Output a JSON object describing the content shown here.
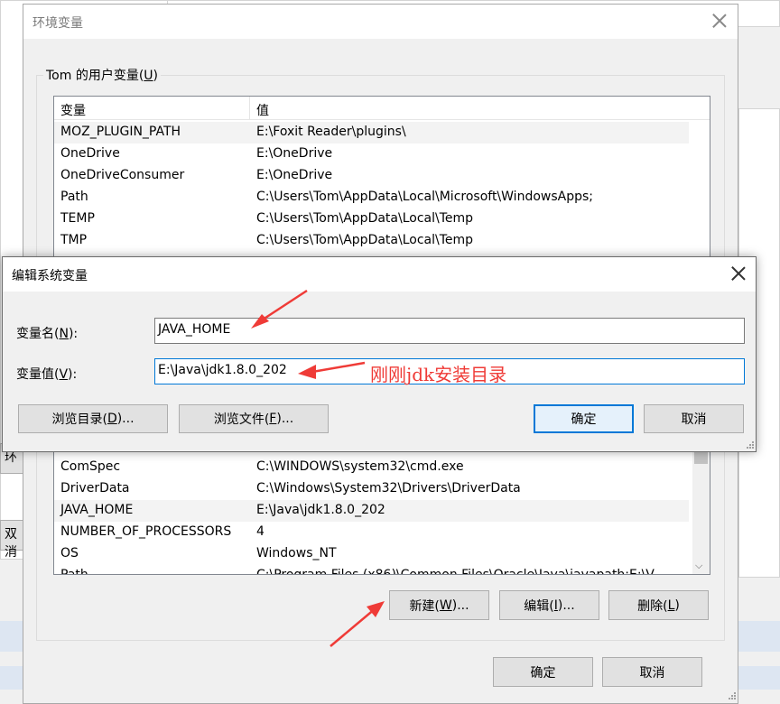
{
  "background": {
    "partial_labels": [
      "环",
      "双消"
    ],
    "accent_colors": {
      "highlight_strip": "#dde6f2",
      "annotation": "#ef3b37",
      "focus_blue": "#0078d7"
    }
  },
  "env_dialog": {
    "title": "环境变量",
    "user_vars": {
      "group_label_prefix": "Tom 的用户变量(",
      "group_label_key": "U",
      "group_label_suffix": ")",
      "columns": [
        "变量",
        "值"
      ],
      "rows": [
        {
          "name": "MOZ_PLUGIN_PATH",
          "value": "E:\\Foxit Reader\\plugins\\"
        },
        {
          "name": "OneDrive",
          "value": "E:\\OneDrive"
        },
        {
          "name": "OneDriveConsumer",
          "value": "E:\\OneDrive"
        },
        {
          "name": "Path",
          "value": "C:\\Users\\Tom\\AppData\\Local\\Microsoft\\WindowsApps;"
        },
        {
          "name": "TEMP",
          "value": "C:\\Users\\Tom\\AppData\\Local\\Temp"
        },
        {
          "name": "TMP",
          "value": "C:\\Users\\Tom\\AppData\\Local\\Temp"
        }
      ]
    },
    "system_vars": {
      "rows": [
        {
          "name": "ComSpec",
          "value": "C:\\WINDOWS\\system32\\cmd.exe"
        },
        {
          "name": "DriverData",
          "value": "C:\\Windows\\System32\\Drivers\\DriverData"
        },
        {
          "name": "JAVA_HOME",
          "value": "E:\\Java\\jdk1.8.0_202"
        },
        {
          "name": "NUMBER_OF_PROCESSORS",
          "value": "4"
        },
        {
          "name": "OS",
          "value": "Windows_NT"
        },
        {
          "name": "Path",
          "value": "C:\\Program Files (x86)\\Common Files\\Oracle\\Java\\javapath;E:\\V"
        }
      ],
      "buttons": {
        "new": {
          "pre": "新建(",
          "key": "W",
          "post": ")..."
        },
        "edit": {
          "pre": "编辑(",
          "key": "I",
          "post": ")..."
        },
        "delete": {
          "pre": "删除(",
          "key": "L",
          "post": ")"
        }
      }
    },
    "ok_label": "确定",
    "cancel_label": "取消"
  },
  "edit_dialog": {
    "title": "编辑系统变量",
    "name_label": {
      "pre": "变量名(",
      "key": "N",
      "post": "):"
    },
    "name_value": "JAVA_HOME",
    "value_label": {
      "pre": "变量值(",
      "key": "V",
      "post": "):"
    },
    "value_value": "E:\\Java\\jdk1.8.0_202",
    "browse_dir": {
      "pre": "浏览目录(",
      "key": "D",
      "post": ")..."
    },
    "browse_file": {
      "pre": "浏览文件(",
      "key": "F",
      "post": ")..."
    },
    "ok_label": "确定",
    "cancel_label": "取消"
  },
  "annotation": {
    "text": "刚刚jdk安装目录"
  }
}
